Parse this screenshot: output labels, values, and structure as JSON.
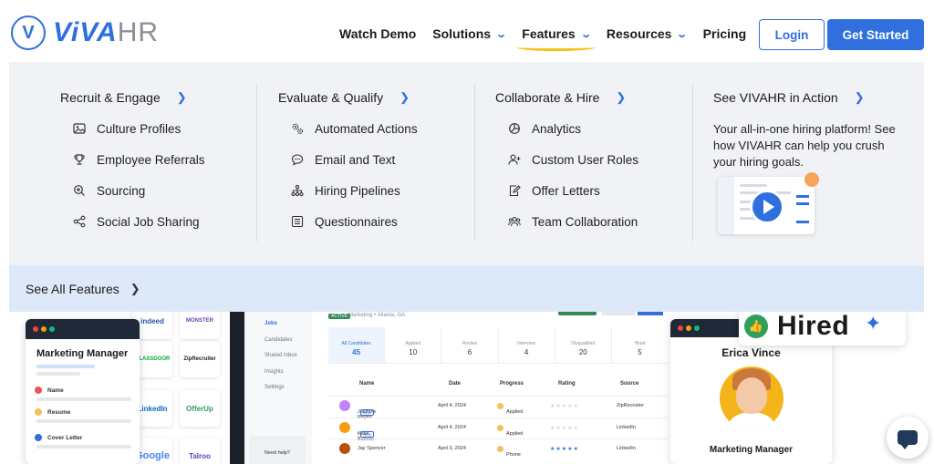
{
  "logo": {
    "mark": "V",
    "brand_part1": "ViVA",
    "brand_part2": "HR"
  },
  "nav": {
    "items": [
      {
        "label": "Watch Demo",
        "has_chevron": false
      },
      {
        "label": "Solutions",
        "has_chevron": true
      },
      {
        "label": "Features",
        "has_chevron": true,
        "active": true
      },
      {
        "label": "Resources",
        "has_chevron": true
      },
      {
        "label": "Pricing",
        "has_chevron": false
      }
    ],
    "login": "Login",
    "get_started": "Get Started"
  },
  "menu": {
    "columns": [
      {
        "heading": "Recruit & Engage",
        "items": [
          {
            "label": "Culture Profiles",
            "icon": "image-icon"
          },
          {
            "label": "Employee Referrals",
            "icon": "trophy-icon"
          },
          {
            "label": "Sourcing",
            "icon": "magnify-plus-icon"
          },
          {
            "label": "Social Job Sharing",
            "icon": "share-icon"
          }
        ]
      },
      {
        "heading": "Evaluate & Qualify",
        "items": [
          {
            "label": "Automated Actions",
            "icon": "gears-icon"
          },
          {
            "label": "Email and Text",
            "icon": "chat-icon"
          },
          {
            "label": "Hiring Pipelines",
            "icon": "hierarchy-icon"
          },
          {
            "label": "Questionnaires",
            "icon": "list-icon"
          }
        ]
      },
      {
        "heading": "Collaborate & Hire",
        "items": [
          {
            "label": "Analytics",
            "icon": "pie-chart-icon"
          },
          {
            "label": "Custom User Roles",
            "icon": "user-plus-icon"
          },
          {
            "label": "Offer Letters",
            "icon": "edit-doc-icon"
          },
          {
            "label": "Team Collaboration",
            "icon": "team-icon"
          }
        ]
      }
    ],
    "action": {
      "heading": "See VIVAHR in Action",
      "text": "Your all-in-one hiring platform! See how VIVAHR can help you crush your hiring goals."
    },
    "see_all": "See All Features"
  },
  "background": {
    "sidenav": [
      "Jobs",
      "Candidates",
      "Shared Inbox",
      "Insights",
      "Settings"
    ],
    "help": "Need help?",
    "status": "ACTIVE",
    "subtitle": "Marketing • Atlanta, GA",
    "stats": [
      {
        "label": "All Candidates",
        "value": "45"
      },
      {
        "label": "Applied",
        "value": "10"
      },
      {
        "label": "Review",
        "value": "6"
      },
      {
        "label": "Interview",
        "value": "4"
      },
      {
        "label": "Disqualified",
        "value": "20"
      },
      {
        "label": "Hired",
        "value": "5"
      }
    ],
    "table_headers": [
      "Name",
      "Date",
      "Progress",
      "Rating",
      "Source"
    ],
    "rows": [
      {
        "name": "Jasmine Reyes",
        "new": "NEW",
        "date": "April 4, 2024",
        "progress": "Applied",
        "source": "ZipRecruiter",
        "rated": false
      },
      {
        "name": "Katie Bullock",
        "new": "NEW",
        "date": "April 4, 2024",
        "progress": "Applied",
        "source": "LinkedIn",
        "rated": false
      },
      {
        "name": "Jay Spencer",
        "new": "",
        "date": "April 3, 2024",
        "progress": "Phone",
        "source": "LinkedIn",
        "rated": true
      }
    ],
    "job_card": {
      "title": "Marketing Manager",
      "fields": [
        "Name",
        "Resume",
        "Cover Letter"
      ]
    },
    "job_boards": [
      "indeed",
      "MONSTER",
      "GLASSDOOR",
      "ZipRecruiter",
      "LinkedIn",
      "OfferUp",
      "Google",
      "Talroo"
    ],
    "candidate": {
      "name": "Erica Vince",
      "role": "Marketing Manager"
    },
    "hired_label": "Hired"
  },
  "colors": {
    "accent": "#2f6fde",
    "underline": "#f4c21a",
    "success": "#2e9e5b"
  }
}
